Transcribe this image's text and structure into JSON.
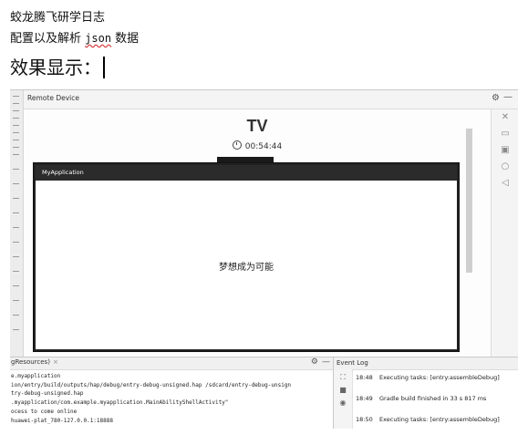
{
  "doc": {
    "title": "蛟龙腾飞研学日志",
    "subtitle_prefix": "配置以及解析 ",
    "subtitle_json": "json",
    "subtitle_suffix": " 数据",
    "effect_heading": "效果显示："
  },
  "remote_device": {
    "title": "Remote Device",
    "device_name": "TV",
    "timer": "00:54:44",
    "app_title": "MyApplication",
    "content_text": "梦想成为可能",
    "toolbar_icons": [
      "close-icon",
      "home-icon",
      "recent-apps-icon",
      "circle-icon",
      "back-icon"
    ]
  },
  "run_panel": {
    "tab_label": "gResources)",
    "lines": [
      "e.myapplication",
      "ion/entry/build/outputs/hap/debug/entry-debug-unsigned.hap /sdcard/entry-debug-unsign",
      "try-debug-unsigned.hap",
      ".myapplication/com.example.myapplication.MainAbilityShellActivity\"",
      "ocess to come online",
      "huawei-plat_780-127.0.0.1:18888"
    ]
  },
  "event_log": {
    "title": "Event Log",
    "entries": [
      {
        "time": "18:48",
        "message": "Executing tasks: [entry:assembleDebug]"
      },
      {
        "time": "18:49",
        "message": "Gradle build finished in 33 s 817 ms"
      },
      {
        "time": "18:50",
        "message": "Executing tasks: [entry:assembleDebug]"
      }
    ]
  }
}
